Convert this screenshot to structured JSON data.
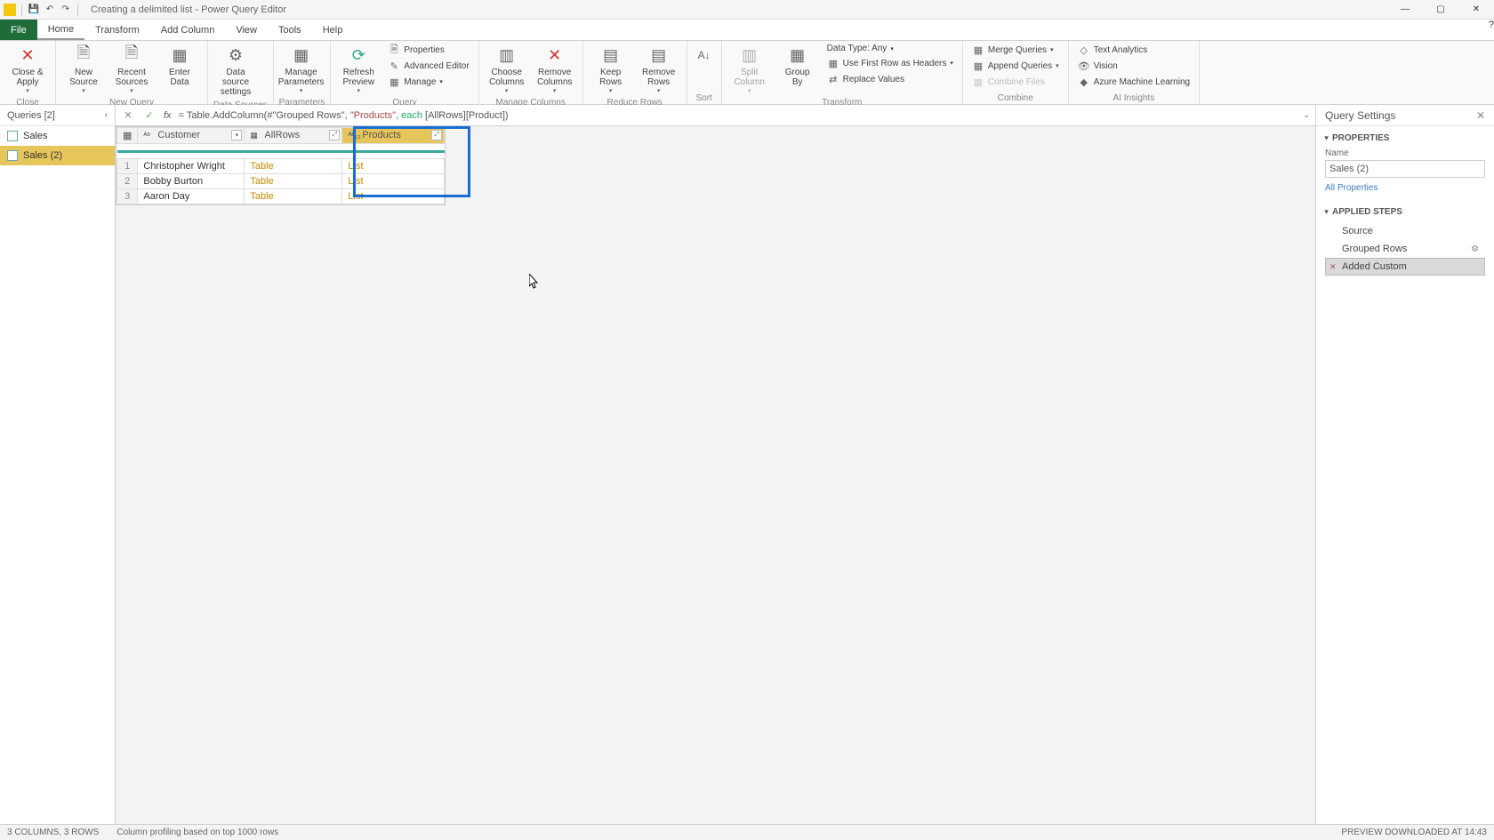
{
  "titlebar": {
    "title": "Creating a delimited list - Power Query Editor"
  },
  "menu": {
    "file": "File",
    "home": "Home",
    "transform": "Transform",
    "add_column": "Add Column",
    "view": "View",
    "tools": "Tools",
    "help": "Help"
  },
  "ribbon": {
    "close_apply": "Close &\nApply",
    "close_group": "Close",
    "new_source": "New\nSource",
    "recent_sources": "Recent\nSources",
    "enter_data": "Enter\nData",
    "new_query_group": "New Query",
    "data_source_settings": "Data source\nsettings",
    "data_sources_group": "Data Sources",
    "manage_parameters": "Manage\nParameters",
    "parameters_group": "Parameters",
    "refresh_preview": "Refresh\nPreview",
    "properties": "Properties",
    "advanced_editor": "Advanced Editor",
    "manage": "Manage",
    "query_group": "Query",
    "choose_columns": "Choose\nColumns",
    "remove_columns": "Remove\nColumns",
    "manage_columns_group": "Manage Columns",
    "keep_rows": "Keep\nRows",
    "remove_rows": "Remove\nRows",
    "reduce_rows_group": "Reduce Rows",
    "sort_group": "Sort",
    "split_column": "Split\nColumn",
    "group_by": "Group\nBy",
    "data_type": "Data Type: Any",
    "first_row_headers": "Use First Row as Headers",
    "replace_values": "Replace Values",
    "transform_group": "Transform",
    "merge_queries": "Merge Queries",
    "append_queries": "Append Queries",
    "combine_files": "Combine Files",
    "combine_group": "Combine",
    "text_analytics": "Text Analytics",
    "vision": "Vision",
    "azure_ml": "Azure Machine Learning",
    "ai_insights_group": "AI Insights"
  },
  "queries": {
    "header": "Queries [2]",
    "items": [
      {
        "name": "Sales"
      },
      {
        "name": "Sales (2)"
      }
    ]
  },
  "formula": {
    "prefix": "= Table.AddColumn(#\"Grouped Rows\", ",
    "str": "\"Products\"",
    "mid": ", ",
    "kw": "each",
    "suffix": " [AllRows][Product])"
  },
  "grid": {
    "columns": {
      "customer": "Customer",
      "allrows": "AllRows",
      "products": "Products"
    },
    "rows": [
      {
        "n": "1",
        "customer": "Christopher Wright",
        "allrows": "Table",
        "products": "List"
      },
      {
        "n": "2",
        "customer": "Bobby Burton",
        "allrows": "Table",
        "products": "List"
      },
      {
        "n": "3",
        "customer": "Aaron Day",
        "allrows": "Table",
        "products": "List"
      }
    ]
  },
  "settings": {
    "header": "Query Settings",
    "properties_title": "PROPERTIES",
    "name_label": "Name",
    "name_value": "Sales (2)",
    "all_properties": "All Properties",
    "applied_steps_title": "APPLIED STEPS",
    "steps": [
      {
        "name": "Source"
      },
      {
        "name": "Grouped Rows"
      },
      {
        "name": "Added Custom"
      }
    ]
  },
  "status": {
    "left": "3 COLUMNS, 3 ROWS",
    "profiling": "Column profiling based on top 1000 rows",
    "right": "PREVIEW DOWNLOADED AT 14:43"
  }
}
